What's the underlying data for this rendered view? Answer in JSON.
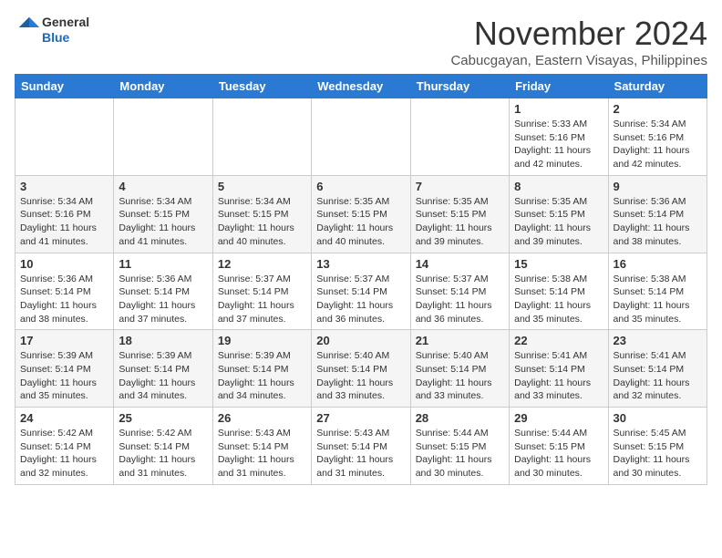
{
  "logo": {
    "general": "General",
    "blue": "Blue"
  },
  "header": {
    "month": "November 2024",
    "location": "Cabucgayan, Eastern Visayas, Philippines"
  },
  "weekdays": [
    "Sunday",
    "Monday",
    "Tuesday",
    "Wednesday",
    "Thursday",
    "Friday",
    "Saturday"
  ],
  "weeks": [
    [
      {
        "day": "",
        "info": ""
      },
      {
        "day": "",
        "info": ""
      },
      {
        "day": "",
        "info": ""
      },
      {
        "day": "",
        "info": ""
      },
      {
        "day": "",
        "info": ""
      },
      {
        "day": "1",
        "info": "Sunrise: 5:33 AM\nSunset: 5:16 PM\nDaylight: 11 hours and 42 minutes."
      },
      {
        "day": "2",
        "info": "Sunrise: 5:34 AM\nSunset: 5:16 PM\nDaylight: 11 hours and 42 minutes."
      }
    ],
    [
      {
        "day": "3",
        "info": "Sunrise: 5:34 AM\nSunset: 5:16 PM\nDaylight: 11 hours and 41 minutes."
      },
      {
        "day": "4",
        "info": "Sunrise: 5:34 AM\nSunset: 5:15 PM\nDaylight: 11 hours and 41 minutes."
      },
      {
        "day": "5",
        "info": "Sunrise: 5:34 AM\nSunset: 5:15 PM\nDaylight: 11 hours and 40 minutes."
      },
      {
        "day": "6",
        "info": "Sunrise: 5:35 AM\nSunset: 5:15 PM\nDaylight: 11 hours and 40 minutes."
      },
      {
        "day": "7",
        "info": "Sunrise: 5:35 AM\nSunset: 5:15 PM\nDaylight: 11 hours and 39 minutes."
      },
      {
        "day": "8",
        "info": "Sunrise: 5:35 AM\nSunset: 5:15 PM\nDaylight: 11 hours and 39 minutes."
      },
      {
        "day": "9",
        "info": "Sunrise: 5:36 AM\nSunset: 5:14 PM\nDaylight: 11 hours and 38 minutes."
      }
    ],
    [
      {
        "day": "10",
        "info": "Sunrise: 5:36 AM\nSunset: 5:14 PM\nDaylight: 11 hours and 38 minutes."
      },
      {
        "day": "11",
        "info": "Sunrise: 5:36 AM\nSunset: 5:14 PM\nDaylight: 11 hours and 37 minutes."
      },
      {
        "day": "12",
        "info": "Sunrise: 5:37 AM\nSunset: 5:14 PM\nDaylight: 11 hours and 37 minutes."
      },
      {
        "day": "13",
        "info": "Sunrise: 5:37 AM\nSunset: 5:14 PM\nDaylight: 11 hours and 36 minutes."
      },
      {
        "day": "14",
        "info": "Sunrise: 5:37 AM\nSunset: 5:14 PM\nDaylight: 11 hours and 36 minutes."
      },
      {
        "day": "15",
        "info": "Sunrise: 5:38 AM\nSunset: 5:14 PM\nDaylight: 11 hours and 35 minutes."
      },
      {
        "day": "16",
        "info": "Sunrise: 5:38 AM\nSunset: 5:14 PM\nDaylight: 11 hours and 35 minutes."
      }
    ],
    [
      {
        "day": "17",
        "info": "Sunrise: 5:39 AM\nSunset: 5:14 PM\nDaylight: 11 hours and 35 minutes."
      },
      {
        "day": "18",
        "info": "Sunrise: 5:39 AM\nSunset: 5:14 PM\nDaylight: 11 hours and 34 minutes."
      },
      {
        "day": "19",
        "info": "Sunrise: 5:39 AM\nSunset: 5:14 PM\nDaylight: 11 hours and 34 minutes."
      },
      {
        "day": "20",
        "info": "Sunrise: 5:40 AM\nSunset: 5:14 PM\nDaylight: 11 hours and 33 minutes."
      },
      {
        "day": "21",
        "info": "Sunrise: 5:40 AM\nSunset: 5:14 PM\nDaylight: 11 hours and 33 minutes."
      },
      {
        "day": "22",
        "info": "Sunrise: 5:41 AM\nSunset: 5:14 PM\nDaylight: 11 hours and 33 minutes."
      },
      {
        "day": "23",
        "info": "Sunrise: 5:41 AM\nSunset: 5:14 PM\nDaylight: 11 hours and 32 minutes."
      }
    ],
    [
      {
        "day": "24",
        "info": "Sunrise: 5:42 AM\nSunset: 5:14 PM\nDaylight: 11 hours and 32 minutes."
      },
      {
        "day": "25",
        "info": "Sunrise: 5:42 AM\nSunset: 5:14 PM\nDaylight: 11 hours and 31 minutes."
      },
      {
        "day": "26",
        "info": "Sunrise: 5:43 AM\nSunset: 5:14 PM\nDaylight: 11 hours and 31 minutes."
      },
      {
        "day": "27",
        "info": "Sunrise: 5:43 AM\nSunset: 5:14 PM\nDaylight: 11 hours and 31 minutes."
      },
      {
        "day": "28",
        "info": "Sunrise: 5:44 AM\nSunset: 5:15 PM\nDaylight: 11 hours and 30 minutes."
      },
      {
        "day": "29",
        "info": "Sunrise: 5:44 AM\nSunset: 5:15 PM\nDaylight: 11 hours and 30 minutes."
      },
      {
        "day": "30",
        "info": "Sunrise: 5:45 AM\nSunset: 5:15 PM\nDaylight: 11 hours and 30 minutes."
      }
    ]
  ]
}
